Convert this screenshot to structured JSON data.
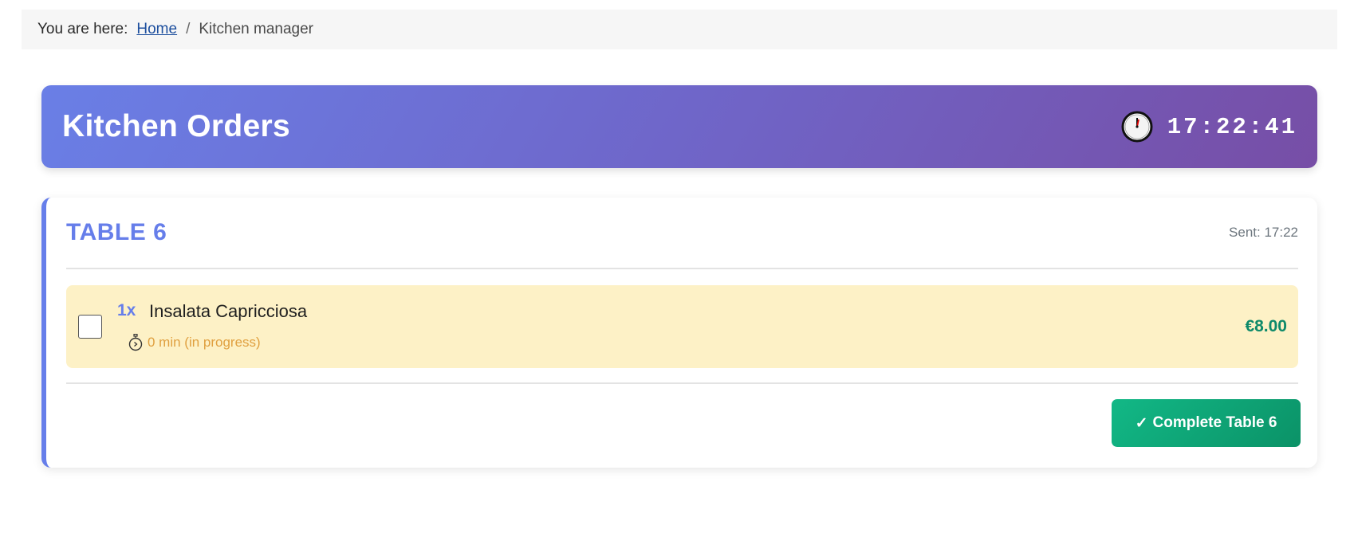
{
  "breadcrumb": {
    "label": "You are here:",
    "home": "Home",
    "separator": "/",
    "current": "Kitchen manager"
  },
  "header": {
    "title": "Kitchen Orders",
    "clock_icon": "clock-icon",
    "time": "17:22:41"
  },
  "order": {
    "table_label": "TABLE 6",
    "sent": "Sent: 17:22",
    "items": [
      {
        "quantity": "1x",
        "name": "Insalata Capricciosa",
        "timer_icon": "stopwatch-icon",
        "status": "0 min (in progress)",
        "price": "€8.00",
        "checked": false
      }
    ],
    "complete_check": "✓",
    "complete_label": "Complete Table 6"
  },
  "colors": {
    "accent": "#667eea",
    "header_gradient_end": "#764ba2",
    "item_bg": "#fdf1c6",
    "status": "#e0a040",
    "price": "#0e8a6a",
    "button": "#12b886"
  }
}
